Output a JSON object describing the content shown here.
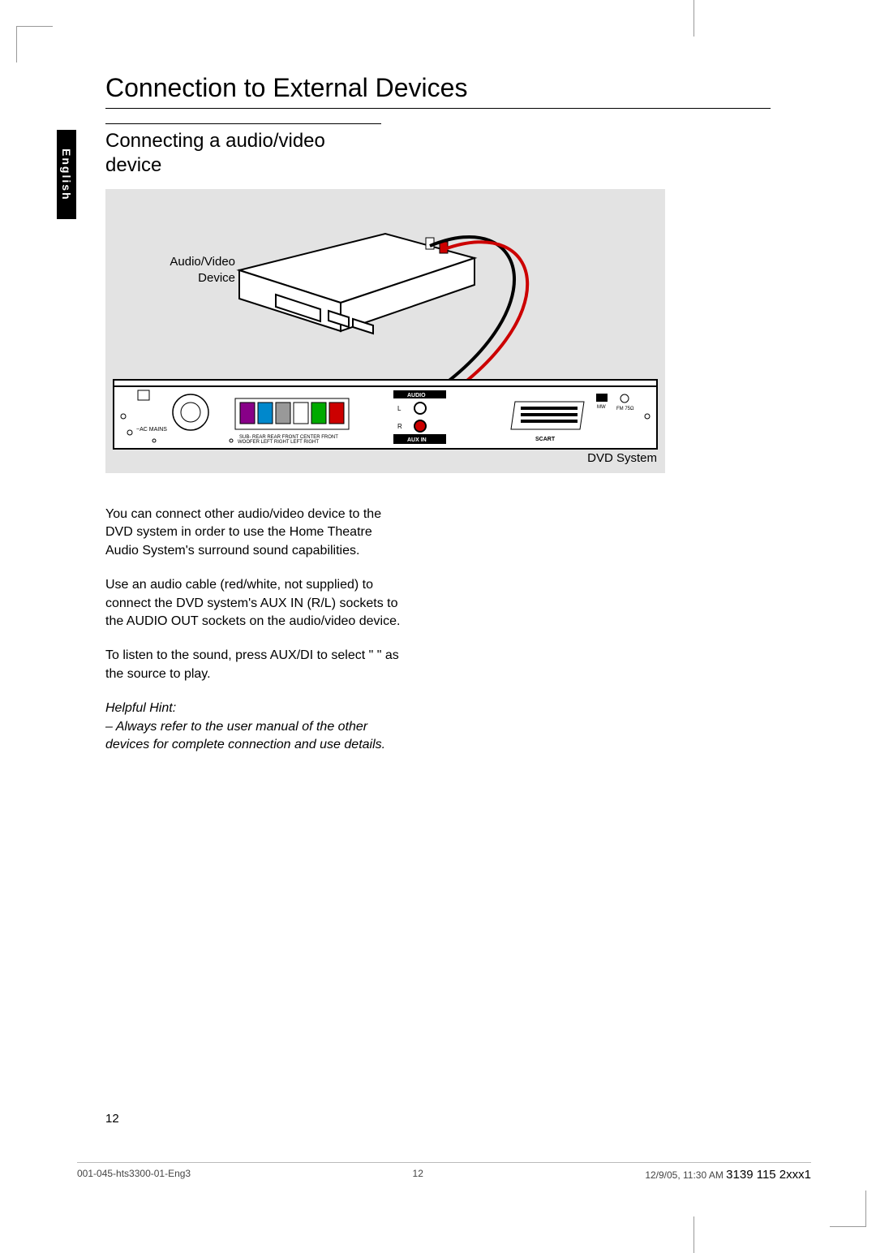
{
  "language_tab": "English",
  "title": "Connection to External Devices",
  "subtitle": "Connecting a audio/video device",
  "diagram": {
    "av_label": "Audio/Video Device",
    "dvd_label": "DVD System",
    "panel": {
      "audio": "AUDIO",
      "l": "L",
      "r": "R",
      "aux_in": "AUX IN",
      "scart": "SCART",
      "mw": "MW",
      "fm": "FM 75Ω",
      "ac": "~AC MAINS",
      "speaker_labels": [
        "SUB-WOOFER",
        "REAR LEFT",
        "REAR RIGHT",
        "FRONT LEFT",
        "CENTER",
        "FRONT RIGHT"
      ]
    }
  },
  "paragraphs": {
    "p1": "You can connect other audio/video device to the DVD system in order to use the Home Theatre Audio System's surround sound capabilities.",
    "p2": "Use an audio cable (red/white, not supplied) to connect the DVD system's AUX IN (R/L)   sockets to the AUDIO OUT sockets on the audio/video device.",
    "p3": "To listen to the sound, press AUX/DI   to select \"       \" as the source to play.",
    "hint_label": "Helpful Hint:",
    "hint": "– Always refer to the user manual of the other devices for complete connection and use details."
  },
  "page_number": "12",
  "footer": {
    "left": "001-045-hts3300-01-Eng3",
    "center": "12",
    "timestamp": "12/9/05, 11:30 AM",
    "part_number": "3139 115 2xxx1"
  }
}
